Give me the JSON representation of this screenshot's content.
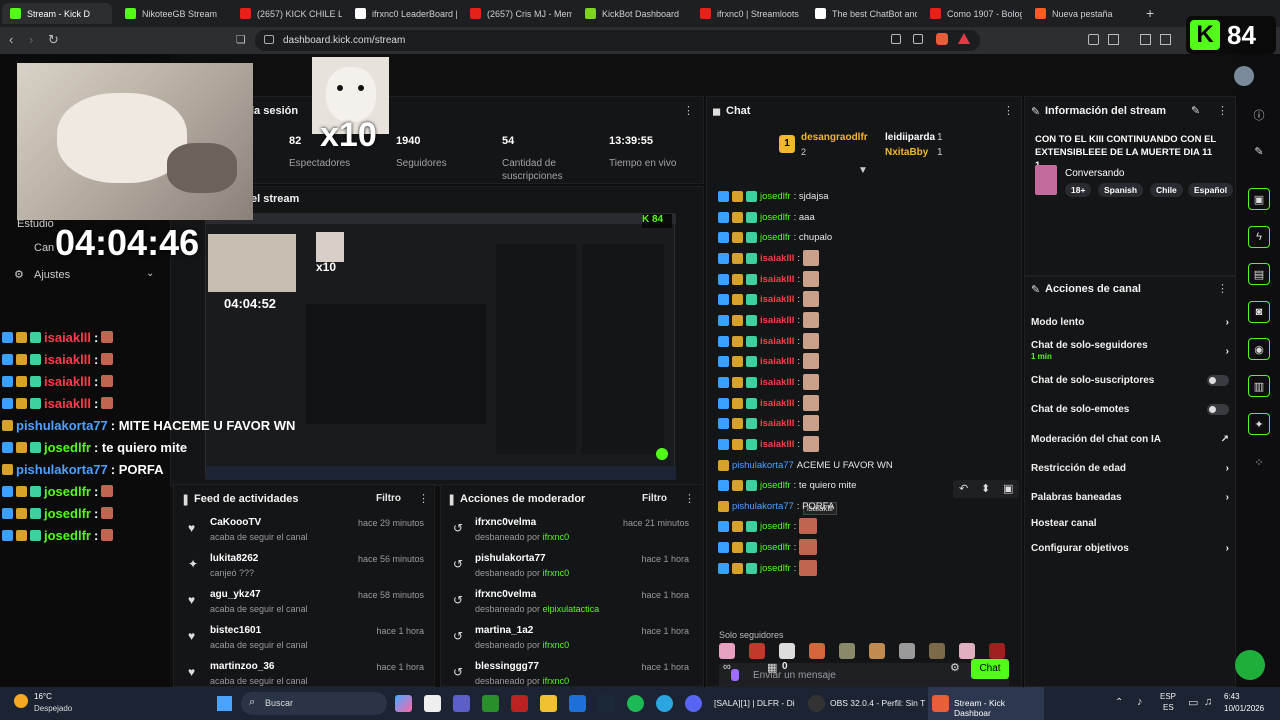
{
  "browser": {
    "tabs": [
      {
        "label": "Stream - Kick D",
        "color": "#53fc18",
        "active": true
      },
      {
        "label": "NikoteeGB Stream",
        "color": "#53fc18"
      },
      {
        "label": "(2657) KICK CHILE LLEG",
        "color": "#e62117"
      },
      {
        "label": "ifrxnc0 LeaderBoard |",
        "color": "#ffffff"
      },
      {
        "label": "(2657) Cris MJ - Meme",
        "color": "#e62117"
      },
      {
        "label": "KickBot Dashboard",
        "color": "#7ed321"
      },
      {
        "label": "ifrxnc0 | Streamloots |",
        "color": "#e62117"
      },
      {
        "label": "The best ChatBot and",
        "color": "#ffffff"
      },
      {
        "label": "Como 1907 - Bologna",
        "color": "#e62117"
      },
      {
        "label": "Nueva pestaña",
        "color": "#ff5a1f"
      }
    ],
    "url": "dashboard.kick.com/stream",
    "kick_badge_number": "84"
  },
  "stats": {
    "session_title": "la sesión",
    "viewers_value": "82",
    "viewers_label": "Espectadores",
    "followers_value": "1940",
    "followers_label": "Seguidores",
    "subs_value": "54",
    "subs_label": "Cantidad de suscripciones",
    "uptime_value": "13:39:55",
    "uptime_label": "Tiempo en vivo",
    "multiplier": "x10"
  },
  "preview": {
    "title": "el stream",
    "timer": "04:04:46",
    "inner_timer": "04:04:52"
  },
  "left_menu": {
    "item1": "Estudio",
    "item2": "Can",
    "item3": "Ajustes"
  },
  "overlay_chat": [
    {
      "user": "isaiaklll",
      "text": ":",
      "color": "#ff3b4b",
      "emote": true
    },
    {
      "user": "isaiaklll",
      "text": ":",
      "color": "#ff3b4b",
      "emote": true
    },
    {
      "user": "isaiaklll",
      "text": ":",
      "color": "#ff3b4b",
      "emote": true
    },
    {
      "user": "isaiaklll",
      "text": ":",
      "color": "#ff3b4b",
      "emote": true
    },
    {
      "user": "pishulakorta77",
      "text": ": MITE HACEME U FAVOR WN",
      "color": "#4ea0ff",
      "emote": false
    },
    {
      "user": "josedlfr",
      "text": ": te quiero mite",
      "color": "#53fc18",
      "emote": false
    },
    {
      "user": "pishulakorta77",
      "text": ": PORFA",
      "color": "#4ea0ff",
      "emote": false
    },
    {
      "user": "josedlfr",
      "text": ":",
      "color": "#53fc18",
      "emote": true
    },
    {
      "user": "josedlfr",
      "text": ":",
      "color": "#53fc18",
      "emote": true
    },
    {
      "user": "josedlfr",
      "text": ":",
      "color": "#53fc18",
      "emote": true
    }
  ],
  "chat": {
    "title": "Chat",
    "leader1_rank": "1",
    "leader1_name": "desangraodlfr",
    "leader1_count": "2",
    "leader2_name": "leidiiparda",
    "leader2_count": "1",
    "leader3_name": "NxitaBby",
    "leader3_count": "1",
    "messages": [
      {
        "user": "josedlfr",
        "text": ": sjdajsa",
        "kind": "green"
      },
      {
        "user": "josedlfr",
        "text": ": aaa",
        "kind": "green"
      },
      {
        "user": "josedlfr",
        "text": ": chupalo",
        "kind": "green"
      },
      {
        "user": "isaiaklll",
        "text": ":",
        "kind": "red"
      },
      {
        "user": "isaiaklll",
        "text": ":",
        "kind": "red"
      },
      {
        "user": "isaiaklll",
        "text": ":",
        "kind": "red"
      },
      {
        "user": "isaiaklll",
        "text": ":",
        "kind": "red"
      },
      {
        "user": "isaiaklll",
        "text": ":",
        "kind": "red"
      },
      {
        "user": "isaiaklll",
        "text": ":",
        "kind": "red"
      },
      {
        "user": "isaiaklll",
        "text": ":",
        "kind": "red"
      },
      {
        "user": "isaiaklll",
        "text": ":",
        "kind": "red"
      },
      {
        "user": "isaiaklll",
        "text": ":",
        "kind": "red"
      },
      {
        "user": "isaiaklll",
        "text": ":",
        "kind": "red"
      },
      {
        "user": "pishulakorta77",
        "text": "ACEME U FAVOR WN",
        "kind": "blue"
      },
      {
        "user": "josedlfr",
        "text": ": te quiero mite",
        "kind": "green"
      },
      {
        "user": "pishulakorta77",
        "text": ": PORFA",
        "kind": "blue"
      },
      {
        "user": "josedlfr",
        "text": ":",
        "kind": "green"
      },
      {
        "user": "josedlfr",
        "text": ":",
        "kind": "green"
      },
      {
        "user": "josedlfr",
        "text": ":",
        "kind": "green"
      }
    ],
    "tooltip": "isaiaklll",
    "followers_only": "Solo seguidores",
    "input_placeholder": "Enviar un mensaje",
    "points": "0",
    "send_label": "Chat"
  },
  "stream_info": {
    "title": "Información del stream",
    "stream_title": "CON TO EL KIII CONTINUANDO CON EL EXTENSIBLEEE DE LA MUERTE DIA 11 1...",
    "category": "Conversando",
    "tags": [
      "18+",
      "Spanish",
      "Chile",
      "Español"
    ]
  },
  "channel_actions": {
    "title": "Acciones de canal",
    "slow_mode": "Modo lento",
    "followers_chat": "Chat de solo-seguidores",
    "followers_chat_sub": "1 min",
    "subs_chat": "Chat de solo-suscriptores",
    "emotes_chat": "Chat de solo-emotes",
    "ai_moderation": "Moderación del chat con IA",
    "age_restriction": "Restricción de edad",
    "banned_words": "Palabras baneadas",
    "host": "Hostear canal",
    "goals": "Configurar objetivos"
  },
  "activity_feed": {
    "title": "Feed de actividades",
    "filter": "Filtro",
    "items": [
      {
        "name": "CaKoooTV",
        "sub": "acaba de seguir el canal",
        "time": "hace 29 minutos",
        "icon": "♥"
      },
      {
        "name": "lukita8262",
        "sub": "canjeó ???",
        "time": "hace 56 minutos",
        "icon": "✦"
      },
      {
        "name": "agu_ykz47",
        "sub": "acaba de seguir el canal",
        "time": "hace 58 minutos",
        "icon": "♥"
      },
      {
        "name": "bistec1601",
        "sub": "acaba de seguir el canal",
        "time": "hace 1 hora",
        "icon": "♥"
      },
      {
        "name": "martinzoo_36",
        "sub": "acaba de seguir el canal",
        "time": "hace 1 hora",
        "icon": "♥"
      }
    ]
  },
  "mod_actions": {
    "title": "Acciones de moderador",
    "filter": "Filtro",
    "items": [
      {
        "name": "ifrxnc0velma",
        "sub": "desbaneado por",
        "by": "ifrxnc0",
        "time": "hace 21 minutos"
      },
      {
        "name": "pishulakorta77",
        "sub": "desbaneado por",
        "by": "ifrxnc0",
        "time": "hace 1 hora"
      },
      {
        "name": "ifrxnc0velma",
        "sub": "desbaneado por",
        "by": "elpixulatactica",
        "time": "hace 1 hora"
      },
      {
        "name": "martina_1a2",
        "sub": "desbaneado por",
        "by": "ifrxnc0",
        "time": "hace 1 hora"
      },
      {
        "name": "blessinggg77",
        "sub": "desbaneado por",
        "by": "ifrxnc0",
        "time": "hace 1 hora"
      }
    ]
  },
  "taskbar": {
    "weather_temp": "16°C",
    "weather_desc": "Despejado",
    "search_label": "Buscar",
    "app1": "[SALA][1] | DLFR - Di",
    "app2": "OBS 32.0.4 - Perfil: Sin T",
    "app3": "Stream - Kick Dashboar",
    "lang1": "ESP",
    "lang2": "ES",
    "time": "6:43",
    "date": "10/01/2026"
  }
}
